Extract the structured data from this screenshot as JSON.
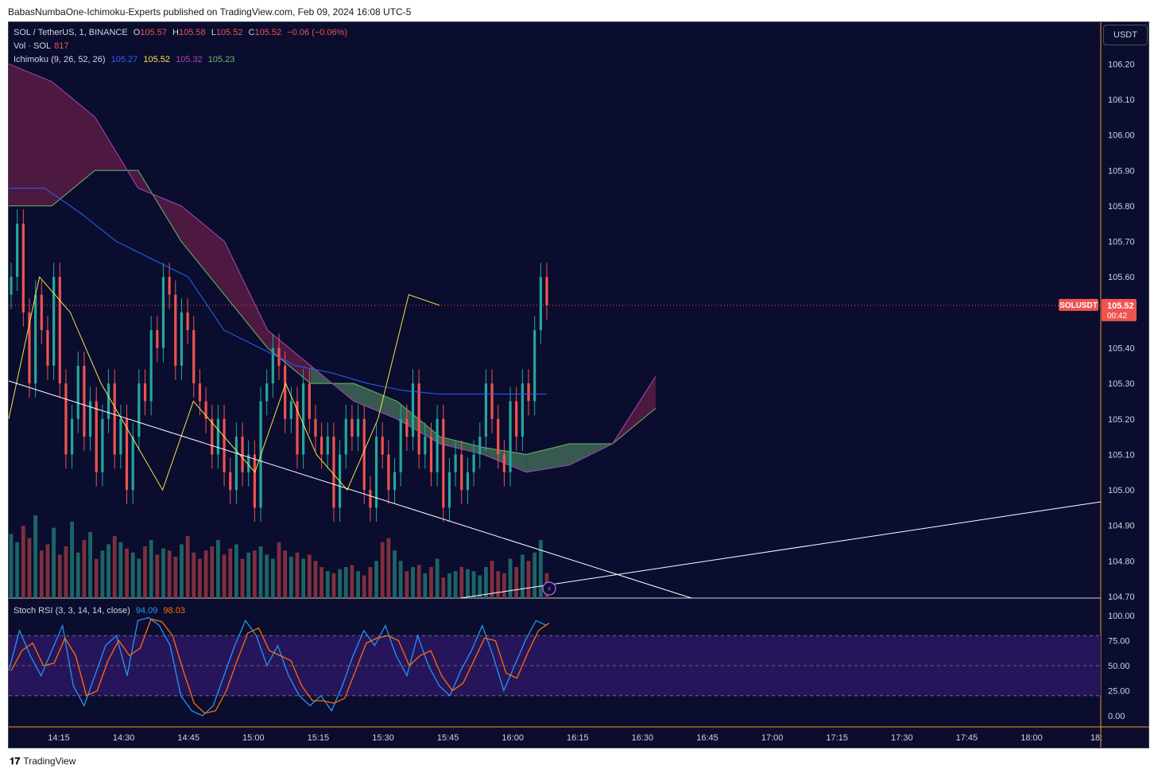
{
  "header": {
    "published": "BabasNumbaOne-Ichimoku-Experts published on TradingView.com, Feb 09, 2024 16:08 UTC-5"
  },
  "legend": {
    "symbol": "SOL / TetherUS, 1, BINANCE",
    "o_label": "O",
    "o_value": "105.57",
    "h_label": "H",
    "h_value": "105.58",
    "l_label": "L",
    "l_value": "105.52",
    "c_label": "C",
    "c_value": "105.52",
    "change": "−0.06 (−0.06%)",
    "vol_label": "Vol · SOL",
    "vol_value": "817",
    "ichimoku_label": "Ichimoku (9, 26, 52, 26)",
    "ichimoku_values": [
      "105.27",
      "105.52",
      "105.32",
      "105.23"
    ],
    "stoch_label": "Stoch RSI (3, 3, 14, 14, close)",
    "stoch_k": "94.09",
    "stoch_d": "98.03"
  },
  "currency_button": "USDT",
  "price_tag": {
    "symbol": "SOLUSDT",
    "price": "105.52",
    "countdown": "00:42"
  },
  "colors": {
    "background": "#0a0d2e",
    "up": "#26a69a",
    "down": "#ef5350",
    "tenkan": "#2962ff",
    "kijun": "#f7e24b",
    "span_b": "#9c27b0",
    "span_a": "#4caf50",
    "stoch_k": "#2196f3",
    "stoch_d": "#ff6d00",
    "rsi_band": "#2a1660"
  },
  "footer": {
    "brand": "TradingView",
    "logo": "tradingview-logo-icon"
  },
  "chart_data": {
    "type": "candlestick",
    "title": "SOL / TetherUS, 1, BINANCE",
    "x_ticks": [
      "14:15",
      "14:30",
      "14:45",
      "15:00",
      "15:15",
      "15:30",
      "15:45",
      "16:00",
      "16:15",
      "16:30",
      "16:45",
      "17:00",
      "17:15",
      "17:30",
      "17:45",
      "18:00",
      "18:"
    ],
    "y_ticks": [
      "106.20",
      "106.10",
      "106.00",
      "105.90",
      "105.80",
      "105.70",
      "105.60",
      "105.50",
      "105.40",
      "105.30",
      "105.20",
      "105.10",
      "105.00",
      "104.90",
      "104.80",
      "104.70"
    ],
    "ylim": [
      104.7,
      106.25
    ],
    "xlim_minutes_from_14_04": [
      0,
      253
    ],
    "stoch_ticks": [
      "100.00",
      "75.00",
      "50.00",
      "25.00",
      "0.00"
    ],
    "stoch_band": [
      20,
      80
    ],
    "ohlc_closes": [
      105.6,
      105.75,
      105.5,
      105.3,
      105.55,
      105.45,
      105.35,
      105.6,
      105.3,
      105.1,
      105.2,
      105.35,
      105.15,
      105.25,
      105.05,
      105.2,
      105.3,
      105.1,
      105.2,
      105.0,
      105.15,
      105.3,
      105.25,
      105.45,
      105.4,
      105.6,
      105.55,
      105.35,
      105.5,
      105.45,
      105.3,
      105.25,
      105.2,
      105.1,
      105.2,
      105.05,
      105.0,
      105.15,
      105.05,
      105.1,
      104.95,
      105.25,
      105.3,
      105.4,
      105.35,
      105.2,
      105.25,
      105.1,
      105.3,
      105.2,
      105.15,
      105.1,
      105.15,
      104.95,
      105.1,
      105.2,
      105.15,
      105.2,
      105.0,
      104.95,
      105.15,
      105.1,
      105.0,
      105.05,
      105.2,
      105.15,
      105.3,
      105.1,
      105.15,
      105.05,
      105.2,
      104.95,
      105.05,
      105.1,
      105.0,
      105.05,
      105.1,
      105.15,
      105.3,
      105.2,
      105.1,
      105.05,
      105.25,
      105.15,
      105.3,
      105.25,
      105.45,
      105.6,
      105.52
    ],
    "volume": [
      620,
      540,
      700,
      580,
      800,
      460,
      520,
      680,
      420,
      500,
      740,
      440,
      560,
      640,
      380,
      460,
      520,
      600,
      540,
      480,
      440,
      380,
      500,
      560,
      420,
      480,
      460,
      400,
      520,
      600,
      440,
      380,
      460,
      500,
      560,
      420,
      480,
      520,
      380,
      440,
      460,
      500,
      420,
      380,
      540,
      460,
      400,
      440,
      380,
      420,
      360,
      300,
      260,
      240,
      280,
      300,
      320,
      260,
      220,
      300,
      360,
      540,
      580,
      460,
      360,
      260,
      300,
      320,
      240,
      300,
      380,
      200,
      240,
      260,
      300,
      280,
      260,
      220,
      300,
      360,
      260,
      240,
      380,
      300,
      420,
      360,
      440,
      560,
      240
    ],
    "tenkan_ichimoku_points": [
      105.85,
      105.85,
      105.78,
      105.7,
      105.65,
      105.6,
      105.45,
      105.4,
      105.35,
      105.33,
      105.3,
      105.28,
      105.27,
      105.27,
      105.27,
      105.27
    ],
    "kijun_ichimoku_points": [
      105.2,
      105.6,
      105.5,
      105.3,
      105.15,
      105.0,
      105.25,
      105.15,
      105.05,
      105.3,
      105.1,
      105.0,
      105.2,
      105.55,
      105.52
    ],
    "cloud_span_a": [
      105.8,
      105.8,
      105.9,
      105.9,
      105.7,
      105.55,
      105.4,
      105.3,
      105.3,
      105.25,
      105.15,
      105.12,
      105.1,
      105.13,
      105.13,
      105.23
    ],
    "cloud_span_b": [
      106.2,
      106.15,
      106.05,
      105.85,
      105.8,
      105.7,
      105.45,
      105.35,
      105.25,
      105.2,
      105.13,
      105.1,
      105.05,
      105.07,
      105.13,
      105.32
    ],
    "stoch_k_points": [
      45,
      85,
      60,
      40,
      65,
      90,
      30,
      10,
      40,
      70,
      80,
      40,
      95,
      98,
      90,
      70,
      20,
      5,
      0,
      10,
      40,
      70,
      95,
      80,
      50,
      70,
      40,
      20,
      10,
      20,
      5,
      30,
      60,
      85,
      70,
      90,
      60,
      40,
      80,
      50,
      30,
      20,
      45,
      65,
      90,
      60,
      25,
      50,
      75,
      95,
      90
    ]
  }
}
